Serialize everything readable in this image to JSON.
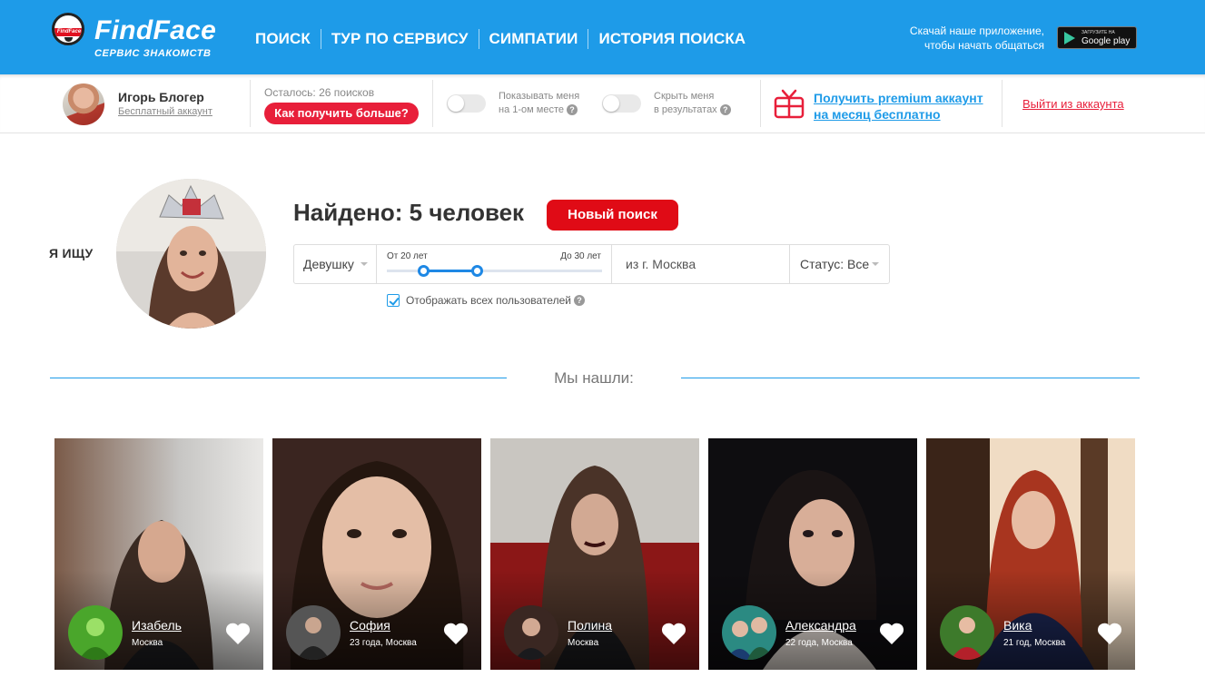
{
  "header": {
    "logo_mini": "FindFace",
    "logo_title": "FindFace",
    "logo_subtitle": "СЕРВИС ЗНАКОМСТВ",
    "nav": [
      "ПОИСК",
      "ТУР ПО СЕРВИСУ",
      "СИМПАТИИ",
      "ИСТОРИЯ ПОИСКА"
    ],
    "app_promo": "Скачай наше приложение, чтобы начать общаться",
    "store_small": "ЗАГРУЗИТЕ НА",
    "store_name": "Google play"
  },
  "userbar": {
    "user_name": "Игорь Блогер",
    "account_type": "Бесплатный аккаунт",
    "searches_left": "Осталось: 26 поисков",
    "get_more": "Как получить больше?",
    "toggle_top_line1": "Показывать меня",
    "toggle_top_line2": "на 1-ом месте",
    "toggle_hide_line1": "Скрыть меня",
    "toggle_hide_line2": "в результатах",
    "premium_line1": "Получить premium аккаунт",
    "premium_line2": "на месяц бесплатно",
    "logout": "Выйти из аккаунта"
  },
  "search": {
    "looking_for": "Я ИЩУ",
    "found": "Найдено: 5 человек",
    "new_search": "Новый поиск",
    "gender": "Девушку",
    "age_from": "От 20 лет",
    "age_to": "До 30 лет",
    "age_min_value": 0.17,
    "age_max_value": 0.42,
    "city": "из г. Москва",
    "status": "Статус: Все",
    "show_all": "Отображать всех пользователей",
    "show_all_checked": true,
    "we_found": "Мы нашли:"
  },
  "colors": {
    "brand_blue": "#1e9be8",
    "accent_red": "#e00b16",
    "pink_button": "#e81f3a"
  },
  "cards": [
    {
      "name": "Изабель",
      "info": "Москва"
    },
    {
      "name": "София",
      "info": "23 года, Москва"
    },
    {
      "name": "Полина",
      "info": "Москва"
    },
    {
      "name": "Александра",
      "info": "22 года, Москва"
    },
    {
      "name": "Вика",
      "info": "21 год, Москва"
    }
  ]
}
